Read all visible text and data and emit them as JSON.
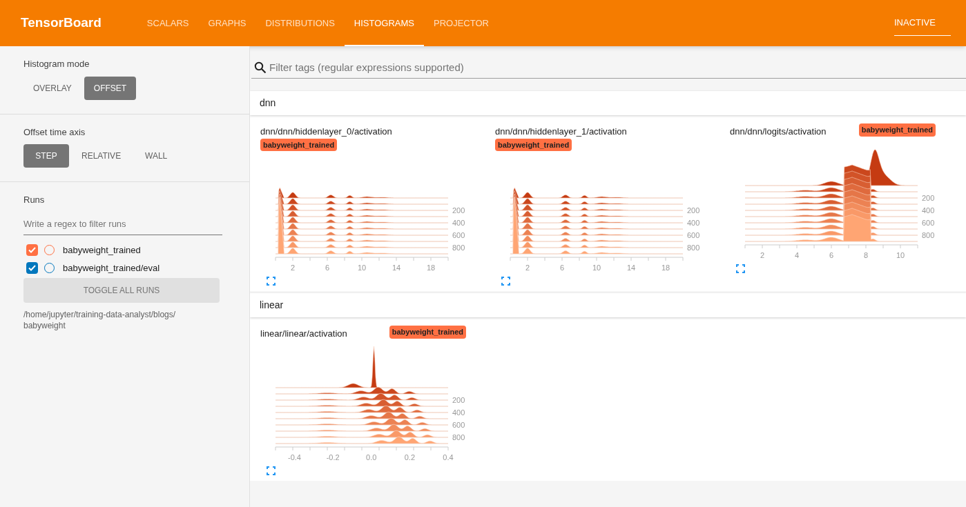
{
  "header": {
    "title": "TensorBoard",
    "tabs": [
      {
        "label": "SCALARS",
        "selected": false
      },
      {
        "label": "GRAPHS",
        "selected": false
      },
      {
        "label": "DISTRIBUTIONS",
        "selected": false
      },
      {
        "label": "HISTOGRAMS",
        "selected": true
      },
      {
        "label": "PROJECTOR",
        "selected": false
      }
    ],
    "status": "INACTIVE"
  },
  "sidebar": {
    "sections": [
      {
        "title": "Histogram mode",
        "options": [
          {
            "label": "OVERLAY",
            "selected": false
          },
          {
            "label": "OFFSET",
            "selected": true
          }
        ]
      },
      {
        "title": "Offset time axis",
        "options": [
          {
            "label": "STEP",
            "selected": true
          },
          {
            "label": "RELATIVE",
            "selected": false
          },
          {
            "label": "WALL",
            "selected": false
          }
        ]
      }
    ],
    "runs": {
      "title": "Runs",
      "placeholder": "Write a regex to filter runs",
      "items": [
        {
          "name": "babyweight_trained",
          "checked": true,
          "color": "#ff7043"
        },
        {
          "name": "babyweight_trained/eval",
          "checked": true,
          "color": "#0277bd"
        }
      ],
      "toggle": "TOGGLE ALL RUNS",
      "path": "/home/jupyter/training-data-analyst/blogs/ babyweight"
    }
  },
  "filter": {
    "placeholder": "Filter tags (regular expressions supported)"
  },
  "categories": [
    {
      "name": "dnn",
      "cards": [
        {
          "title": "dnn/dnn/hiddenlayer_0/activation",
          "run": "babyweight_trained",
          "kind": "spike-left",
          "xticks": [
            "2",
            "6",
            "10",
            "14",
            "18"
          ],
          "steps": [
            "200",
            "400",
            "600",
            "800"
          ]
        },
        {
          "title": "dnn/dnn/hiddenlayer_1/activation",
          "run": "babyweight_trained",
          "kind": "spike-left",
          "xticks": [
            "2",
            "6",
            "10",
            "14",
            "18"
          ],
          "steps": [
            "200",
            "400",
            "600",
            "800"
          ]
        },
        {
          "title": "dnn/dnn/logits/activation",
          "run": "babyweight_trained",
          "kind": "bimodal",
          "xticks": [
            "2",
            "4",
            "6",
            "8",
            "10"
          ],
          "steps": [
            "200",
            "400",
            "600",
            "800"
          ]
        }
      ]
    },
    {
      "name": "linear",
      "cards": [
        {
          "title": "linear/linear/activation",
          "run": "babyweight_trained",
          "kind": "centered",
          "xticks": [
            "-0.4",
            "-0.2",
            "0.0",
            "0.2",
            "0.4"
          ],
          "steps": [
            "200",
            "400",
            "600",
            "800"
          ]
        }
      ]
    }
  ]
}
